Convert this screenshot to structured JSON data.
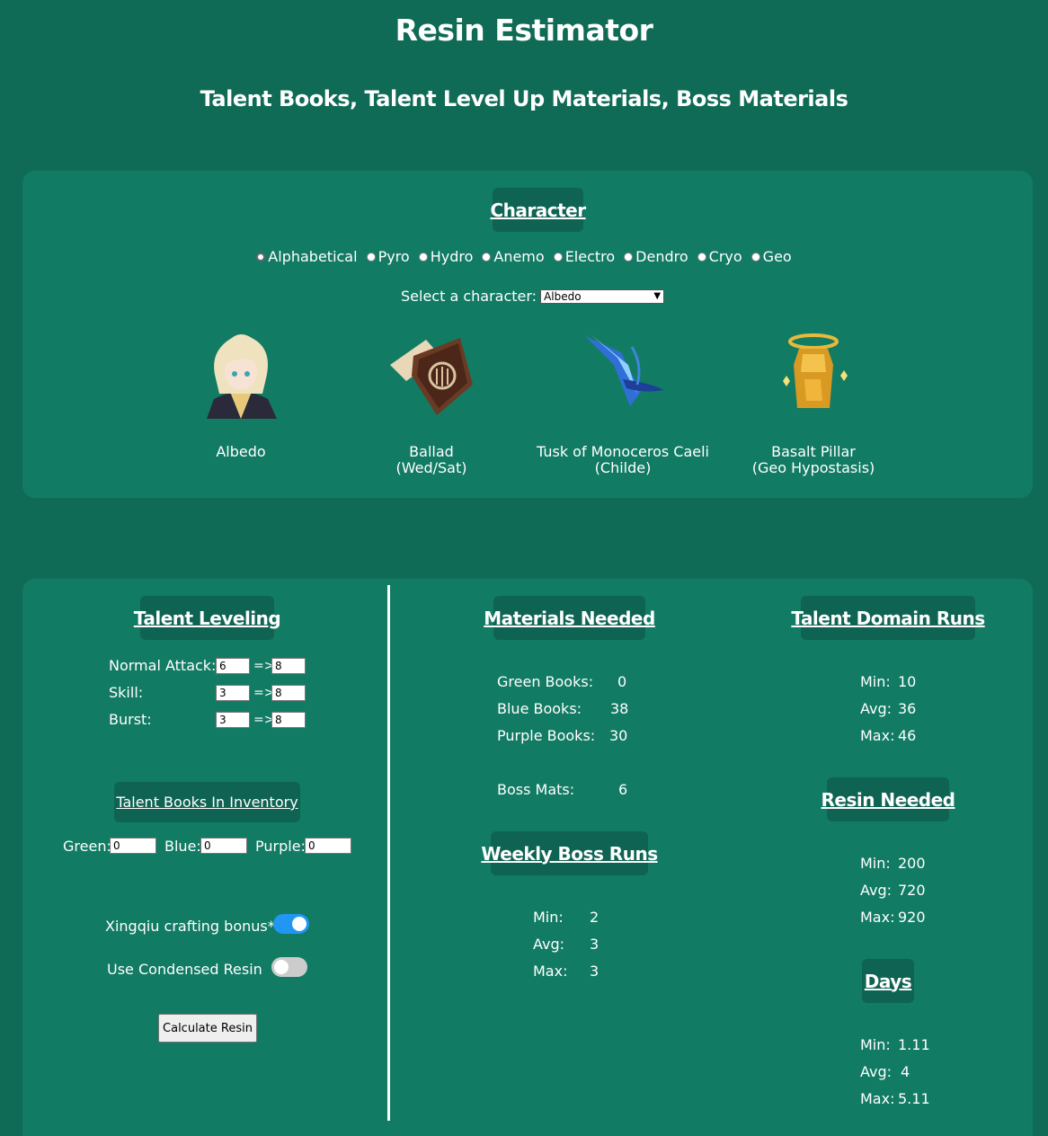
{
  "header": {
    "title": "Resin Estimator",
    "subtitle": "Talent Books, Talent Level Up Materials, Boss Materials"
  },
  "character_section": {
    "heading": "Character",
    "filters": [
      {
        "label": "Alphabetical",
        "checked": true
      },
      {
        "label": "Pyro",
        "checked": false
      },
      {
        "label": "Hydro",
        "checked": false
      },
      {
        "label": "Anemo",
        "checked": false
      },
      {
        "label": "Electro",
        "checked": false
      },
      {
        "label": "Dendro",
        "checked": false
      },
      {
        "label": "Cryo",
        "checked": false
      },
      {
        "label": "Geo",
        "checked": false
      }
    ],
    "select_label": "Select a character:",
    "selected_character": "Albedo",
    "items": [
      {
        "name": "Albedo",
        "sub": "",
        "icon": "albedo-portrait-icon"
      },
      {
        "name": "Ballad",
        "sub": "(Wed/Sat)",
        "icon": "ballad-book-icon"
      },
      {
        "name": "Tusk of Monoceros Caeli",
        "sub": "(Childe)",
        "icon": "tusk-icon"
      },
      {
        "name": "Basalt Pillar",
        "sub": "(Geo Hypostasis)",
        "icon": "basalt-pillar-icon"
      }
    ]
  },
  "talent_leveling": {
    "heading": "Talent Leveling",
    "rows": [
      {
        "label": "Normal Attack:",
        "from": "6",
        "to": "8"
      },
      {
        "label": "Skill:",
        "from": "3",
        "to": "8"
      },
      {
        "label": "Burst:",
        "from": "3",
        "to": "8"
      }
    ],
    "arrow": "=>"
  },
  "inventory": {
    "heading": "Talent Books In Inventory",
    "green_label": "Green:",
    "green_value": "0",
    "blue_label": "Blue:",
    "blue_value": "0",
    "purple_label": "Purple:",
    "purple_value": "0"
  },
  "options": {
    "xingqiu_label": "Xingqiu crafting bonus*",
    "xingqiu_on": true,
    "condensed_label": "Use Condensed Resin",
    "condensed_on": false,
    "calculate_label": "Calculate Resin"
  },
  "materials_needed": {
    "heading": "Materials Needed",
    "green_label": "Green Books:",
    "green": "0",
    "blue_label": "Blue Books:",
    "blue": "38",
    "purple_label": "Purple Books:",
    "purple": "30",
    "boss_label": "Boss Mats:",
    "boss": "6"
  },
  "weekly_boss_runs": {
    "heading": "Weekly Boss Runs",
    "min_label": "Min:",
    "min": "2",
    "avg_label": "Avg:",
    "avg": "3",
    "max_label": "Max:",
    "max": "3"
  },
  "talent_domain_runs": {
    "heading": "Talent Domain Runs",
    "min_label": "Min:",
    "min": "10",
    "avg_label": "Avg:",
    "avg": "36",
    "max_label": "Max:",
    "max": "46"
  },
  "resin_needed": {
    "heading": "Resin Needed",
    "min_label": "Min:",
    "min": "200",
    "avg_label": "Avg:",
    "avg": "720",
    "max_label": "Max:",
    "max": "920"
  },
  "days": {
    "heading": "Days",
    "min_label": "Min:",
    "min": "1.11",
    "avg_label": "Avg:",
    "avg": "4",
    "max_label": "Max:",
    "max": "5.11"
  }
}
